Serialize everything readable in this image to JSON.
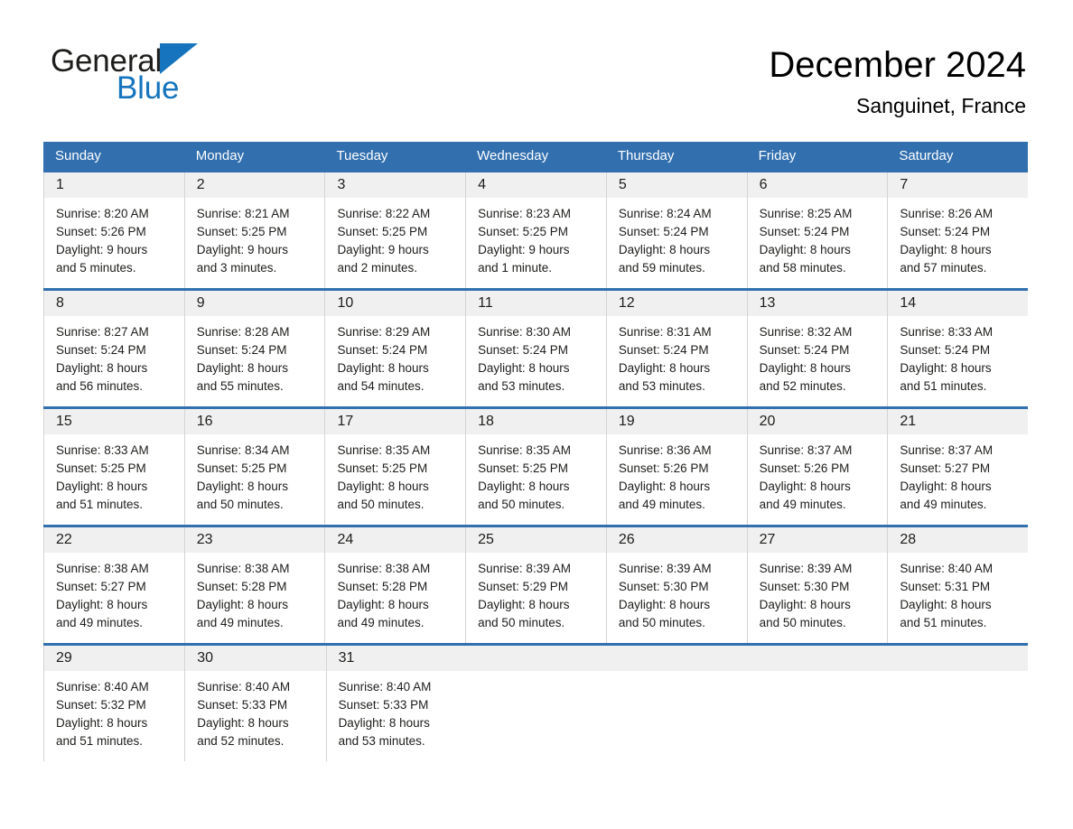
{
  "brand": {
    "word_general": "General",
    "word_blue": "Blue",
    "logo_icon": "triangle-logo-icon",
    "accent_color": "#1574bd"
  },
  "header": {
    "title": "December 2024",
    "location": "Sanguinet, France",
    "header_bg_color": "#316FAE",
    "daynum_strip_color": "#f0f0f0"
  },
  "weekdays": [
    "Sunday",
    "Monday",
    "Tuesday",
    "Wednesday",
    "Thursday",
    "Friday",
    "Saturday"
  ],
  "weeks": [
    [
      {
        "day": "1",
        "sunrise": "Sunrise: 8:20 AM",
        "sunset": "Sunset: 5:26 PM",
        "daylight_line1": "Daylight: 9 hours",
        "daylight_line2": "and 5 minutes."
      },
      {
        "day": "2",
        "sunrise": "Sunrise: 8:21 AM",
        "sunset": "Sunset: 5:25 PM",
        "daylight_line1": "Daylight: 9 hours",
        "daylight_line2": "and 3 minutes."
      },
      {
        "day": "3",
        "sunrise": "Sunrise: 8:22 AM",
        "sunset": "Sunset: 5:25 PM",
        "daylight_line1": "Daylight: 9 hours",
        "daylight_line2": "and 2 minutes."
      },
      {
        "day": "4",
        "sunrise": "Sunrise: 8:23 AM",
        "sunset": "Sunset: 5:25 PM",
        "daylight_line1": "Daylight: 9 hours",
        "daylight_line2": "and 1 minute."
      },
      {
        "day": "5",
        "sunrise": "Sunrise: 8:24 AM",
        "sunset": "Sunset: 5:24 PM",
        "daylight_line1": "Daylight: 8 hours",
        "daylight_line2": "and 59 minutes."
      },
      {
        "day": "6",
        "sunrise": "Sunrise: 8:25 AM",
        "sunset": "Sunset: 5:24 PM",
        "daylight_line1": "Daylight: 8 hours",
        "daylight_line2": "and 58 minutes."
      },
      {
        "day": "7",
        "sunrise": "Sunrise: 8:26 AM",
        "sunset": "Sunset: 5:24 PM",
        "daylight_line1": "Daylight: 8 hours",
        "daylight_line2": "and 57 minutes."
      }
    ],
    [
      {
        "day": "8",
        "sunrise": "Sunrise: 8:27 AM",
        "sunset": "Sunset: 5:24 PM",
        "daylight_line1": "Daylight: 8 hours",
        "daylight_line2": "and 56 minutes."
      },
      {
        "day": "9",
        "sunrise": "Sunrise: 8:28 AM",
        "sunset": "Sunset: 5:24 PM",
        "daylight_line1": "Daylight: 8 hours",
        "daylight_line2": "and 55 minutes."
      },
      {
        "day": "10",
        "sunrise": "Sunrise: 8:29 AM",
        "sunset": "Sunset: 5:24 PM",
        "daylight_line1": "Daylight: 8 hours",
        "daylight_line2": "and 54 minutes."
      },
      {
        "day": "11",
        "sunrise": "Sunrise: 8:30 AM",
        "sunset": "Sunset: 5:24 PM",
        "daylight_line1": "Daylight: 8 hours",
        "daylight_line2": "and 53 minutes."
      },
      {
        "day": "12",
        "sunrise": "Sunrise: 8:31 AM",
        "sunset": "Sunset: 5:24 PM",
        "daylight_line1": "Daylight: 8 hours",
        "daylight_line2": "and 53 minutes."
      },
      {
        "day": "13",
        "sunrise": "Sunrise: 8:32 AM",
        "sunset": "Sunset: 5:24 PM",
        "daylight_line1": "Daylight: 8 hours",
        "daylight_line2": "and 52 minutes."
      },
      {
        "day": "14",
        "sunrise": "Sunrise: 8:33 AM",
        "sunset": "Sunset: 5:24 PM",
        "daylight_line1": "Daylight: 8 hours",
        "daylight_line2": "and 51 minutes."
      }
    ],
    [
      {
        "day": "15",
        "sunrise": "Sunrise: 8:33 AM",
        "sunset": "Sunset: 5:25 PM",
        "daylight_line1": "Daylight: 8 hours",
        "daylight_line2": "and 51 minutes."
      },
      {
        "day": "16",
        "sunrise": "Sunrise: 8:34 AM",
        "sunset": "Sunset: 5:25 PM",
        "daylight_line1": "Daylight: 8 hours",
        "daylight_line2": "and 50 minutes."
      },
      {
        "day": "17",
        "sunrise": "Sunrise: 8:35 AM",
        "sunset": "Sunset: 5:25 PM",
        "daylight_line1": "Daylight: 8 hours",
        "daylight_line2": "and 50 minutes."
      },
      {
        "day": "18",
        "sunrise": "Sunrise: 8:35 AM",
        "sunset": "Sunset: 5:25 PM",
        "daylight_line1": "Daylight: 8 hours",
        "daylight_line2": "and 50 minutes."
      },
      {
        "day": "19",
        "sunrise": "Sunrise: 8:36 AM",
        "sunset": "Sunset: 5:26 PM",
        "daylight_line1": "Daylight: 8 hours",
        "daylight_line2": "and 49 minutes."
      },
      {
        "day": "20",
        "sunrise": "Sunrise: 8:37 AM",
        "sunset": "Sunset: 5:26 PM",
        "daylight_line1": "Daylight: 8 hours",
        "daylight_line2": "and 49 minutes."
      },
      {
        "day": "21",
        "sunrise": "Sunrise: 8:37 AM",
        "sunset": "Sunset: 5:27 PM",
        "daylight_line1": "Daylight: 8 hours",
        "daylight_line2": "and 49 minutes."
      }
    ],
    [
      {
        "day": "22",
        "sunrise": "Sunrise: 8:38 AM",
        "sunset": "Sunset: 5:27 PM",
        "daylight_line1": "Daylight: 8 hours",
        "daylight_line2": "and 49 minutes."
      },
      {
        "day": "23",
        "sunrise": "Sunrise: 8:38 AM",
        "sunset": "Sunset: 5:28 PM",
        "daylight_line1": "Daylight: 8 hours",
        "daylight_line2": "and 49 minutes."
      },
      {
        "day": "24",
        "sunrise": "Sunrise: 8:38 AM",
        "sunset": "Sunset: 5:28 PM",
        "daylight_line1": "Daylight: 8 hours",
        "daylight_line2": "and 49 minutes."
      },
      {
        "day": "25",
        "sunrise": "Sunrise: 8:39 AM",
        "sunset": "Sunset: 5:29 PM",
        "daylight_line1": "Daylight: 8 hours",
        "daylight_line2": "and 50 minutes."
      },
      {
        "day": "26",
        "sunrise": "Sunrise: 8:39 AM",
        "sunset": "Sunset: 5:30 PM",
        "daylight_line1": "Daylight: 8 hours",
        "daylight_line2": "and 50 minutes."
      },
      {
        "day": "27",
        "sunrise": "Sunrise: 8:39 AM",
        "sunset": "Sunset: 5:30 PM",
        "daylight_line1": "Daylight: 8 hours",
        "daylight_line2": "and 50 minutes."
      },
      {
        "day": "28",
        "sunrise": "Sunrise: 8:40 AM",
        "sunset": "Sunset: 5:31 PM",
        "daylight_line1": "Daylight: 8 hours",
        "daylight_line2": "and 51 minutes."
      }
    ],
    [
      {
        "day": "29",
        "sunrise": "Sunrise: 8:40 AM",
        "sunset": "Sunset: 5:32 PM",
        "daylight_line1": "Daylight: 8 hours",
        "daylight_line2": "and 51 minutes."
      },
      {
        "day": "30",
        "sunrise": "Sunrise: 8:40 AM",
        "sunset": "Sunset: 5:33 PM",
        "daylight_line1": "Daylight: 8 hours",
        "daylight_line2": "and 52 minutes."
      },
      {
        "day": "31",
        "sunrise": "Sunrise: 8:40 AM",
        "sunset": "Sunset: 5:33 PM",
        "daylight_line1": "Daylight: 8 hours",
        "daylight_line2": "and 53 minutes."
      },
      {
        "day": "",
        "sunrise": "",
        "sunset": "",
        "daylight_line1": "",
        "daylight_line2": ""
      },
      {
        "day": "",
        "sunrise": "",
        "sunset": "",
        "daylight_line1": "",
        "daylight_line2": ""
      },
      {
        "day": "",
        "sunrise": "",
        "sunset": "",
        "daylight_line1": "",
        "daylight_line2": ""
      },
      {
        "day": "",
        "sunrise": "",
        "sunset": "",
        "daylight_line1": "",
        "daylight_line2": ""
      }
    ]
  ]
}
